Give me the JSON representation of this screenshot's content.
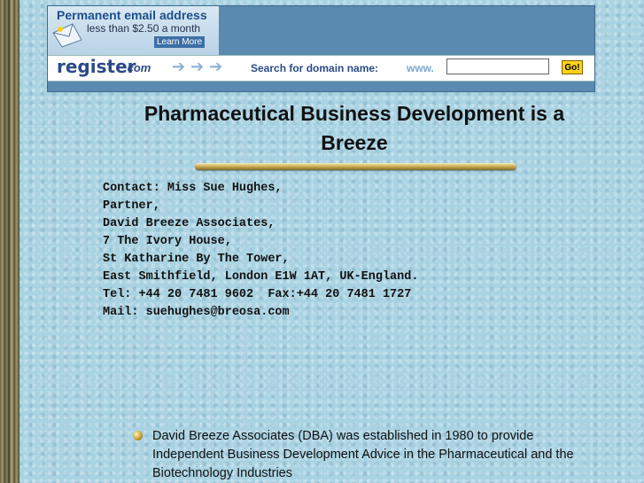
{
  "banner": {
    "ad_title": "Permanent email address",
    "ad_sub": "less than $2.50 a month",
    "ad_learn": "Learn More",
    "logo_main": "register",
    "logo_com": ".com",
    "search_label": "Search for domain name:",
    "www_label": "www.",
    "domain_value": "",
    "go_label": "Go!"
  },
  "title": "Pharmaceutical Business Development is a Breeze",
  "contact": [
    "Contact: Miss Sue Hughes,",
    "Partner,",
    "David Breeze Associates,",
    "7 The Ivory House,",
    "St Katharine By The Tower,",
    "East Smithfield, London E1W 1AT, UK-England.",
    "Tel: +44 20 7481 9602  Fax:+44 20 7481 1727",
    "Mail: suehughes@breosa.com"
  ],
  "bullet": "David Breeze Associates (DBA) was established in 1980 to provide Independent Business Development Advice in the Pharmaceutical and the Biotechnology Industries"
}
